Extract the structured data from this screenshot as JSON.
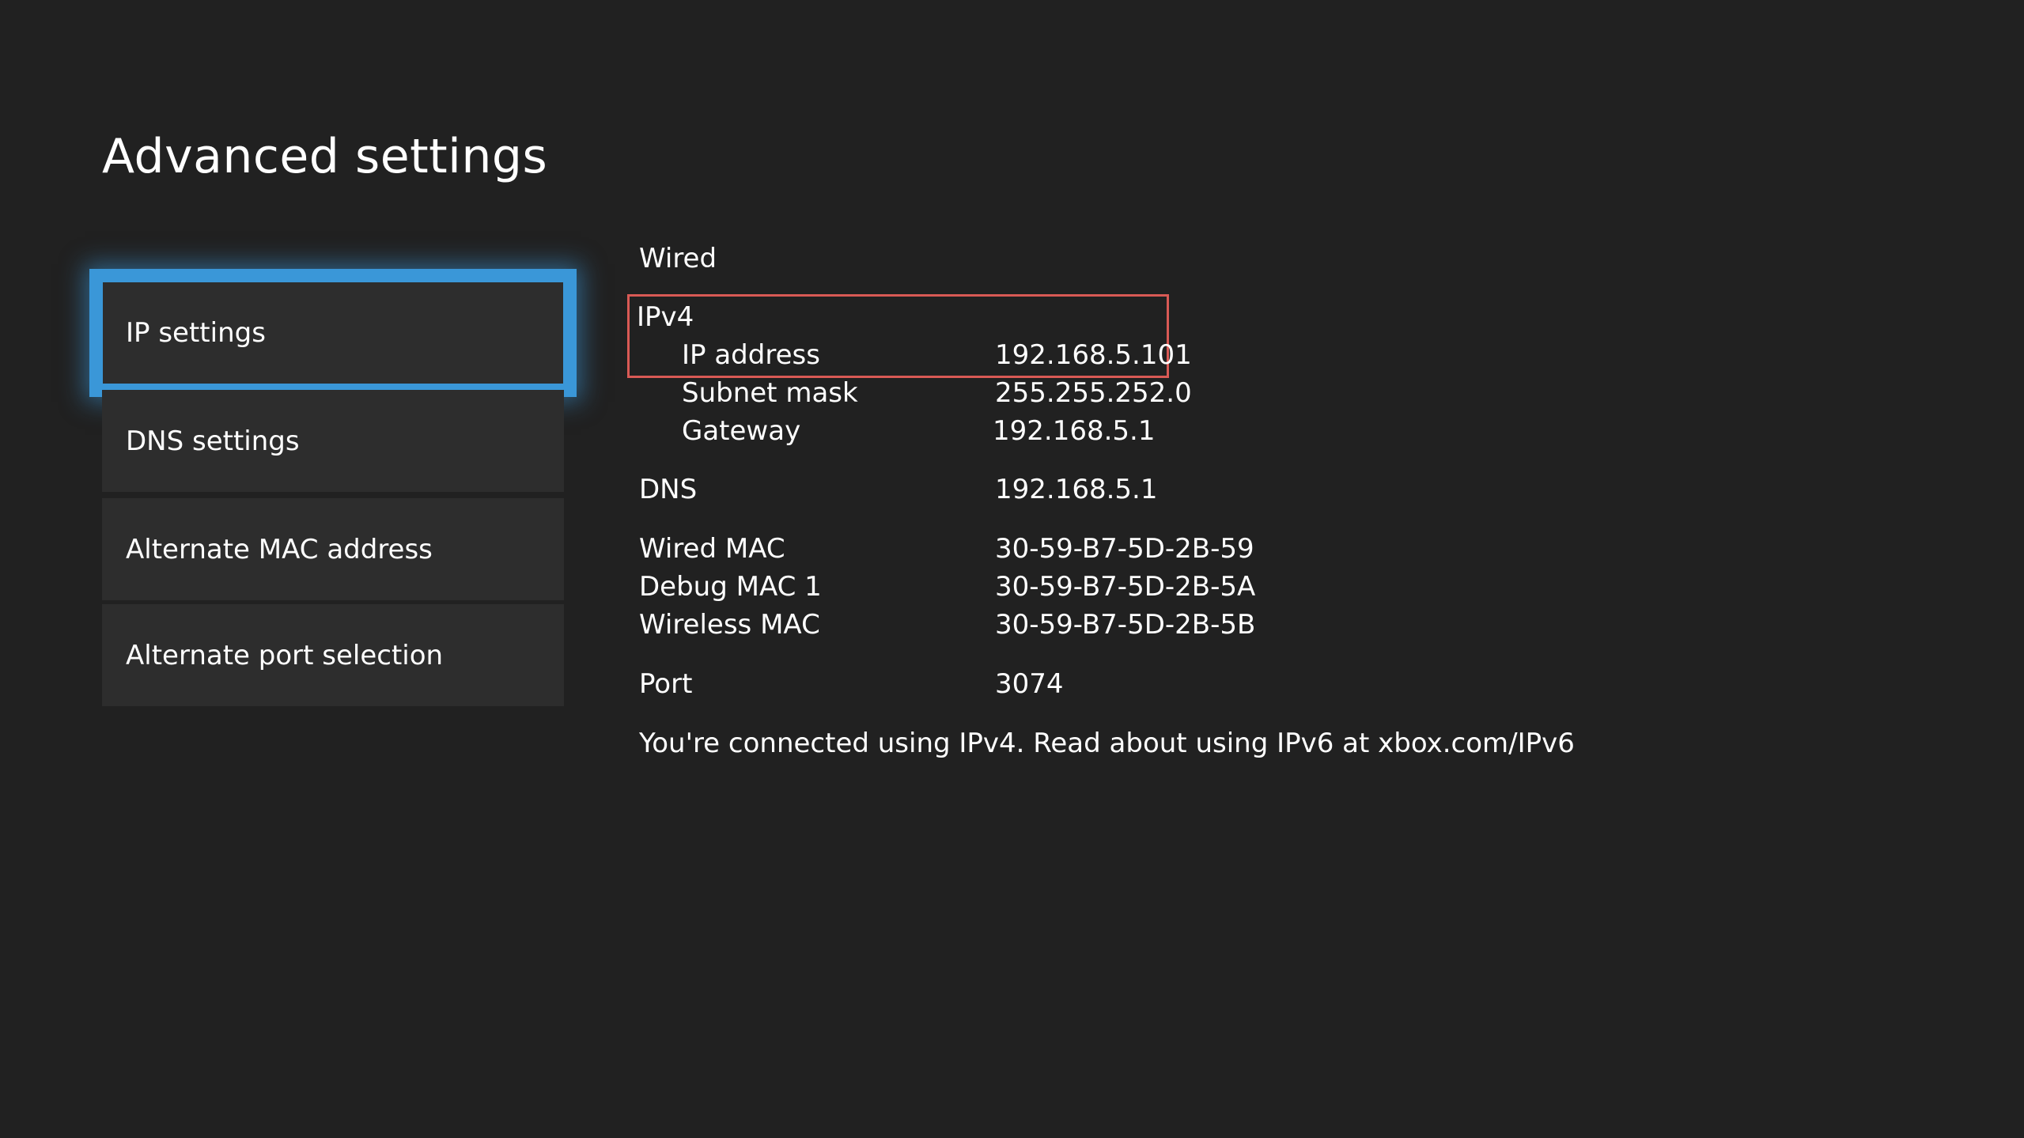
{
  "page": {
    "title": "Advanced settings"
  },
  "menu": {
    "items": [
      {
        "label": "IP settings",
        "selected": true
      },
      {
        "label": "DNS settings"
      },
      {
        "label": "Alternate MAC address"
      },
      {
        "label": "Alternate port selection"
      }
    ]
  },
  "details": {
    "connection_type": "Wired",
    "ipv4_heading": "IPv4",
    "ip_address_label": "IP address",
    "ip_address_value": "192.168.5.101",
    "subnet_mask_label": "Subnet mask",
    "subnet_mask_value": "255.255.252.0",
    "gateway_label": "Gateway",
    "gateway_value": "192.168.5.1",
    "dns_label": "DNS",
    "dns_value": "192.168.5.1",
    "wired_mac_label": "Wired MAC",
    "wired_mac_value": "30-59-B7-5D-2B-59",
    "debug_mac_label": "Debug MAC 1",
    "debug_mac_value": "30-59-B7-5D-2B-5A",
    "wireless_mac_label": "Wireless MAC",
    "wireless_mac_value": "30-59-B7-5D-2B-5B",
    "port_label": "Port",
    "port_value": "3074",
    "footer_note": "You're connected using IPv4. Read about using IPv6 at xbox.com/IPv6"
  },
  "colors": {
    "background": "#212121",
    "tile": "#2d2d2d",
    "focus_accent": "#3a97d8",
    "annotation_box": "#d95a55"
  }
}
